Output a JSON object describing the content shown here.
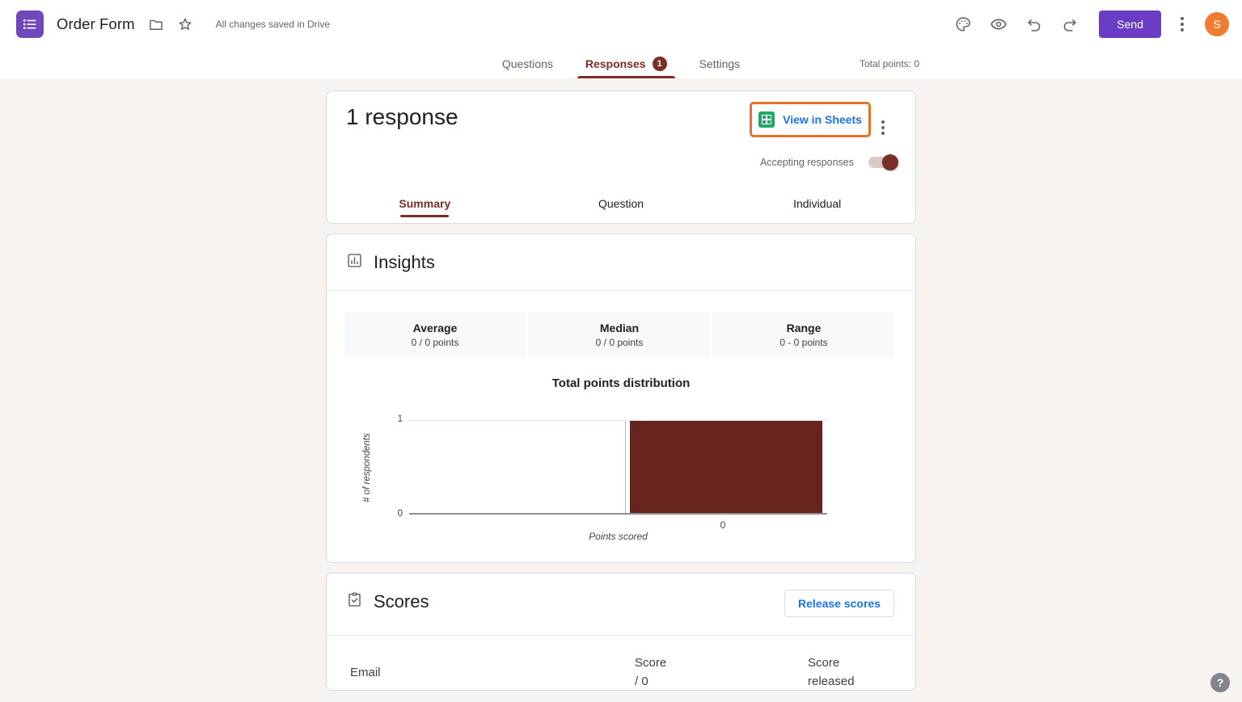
{
  "header": {
    "title": "Order Form",
    "saved_status": "All changes saved in Drive",
    "send_label": "Send",
    "avatar_letter": "S"
  },
  "nav": {
    "tabs": [
      {
        "label": "Questions"
      },
      {
        "label": "Responses",
        "badge": "1"
      },
      {
        "label": "Settings"
      }
    ],
    "total_points": "Total points: 0"
  },
  "response_card": {
    "title": "1 response",
    "view_in_sheets_label": "View in Sheets",
    "accepting_label": "Accepting responses",
    "accepting_on": true,
    "subtabs": [
      {
        "label": "Summary"
      },
      {
        "label": "Question"
      },
      {
        "label": "Individual"
      }
    ]
  },
  "insights": {
    "title": "Insights",
    "stats": [
      {
        "label": "Average",
        "value": "0 / 0 points"
      },
      {
        "label": "Median",
        "value": "0 / 0 points"
      },
      {
        "label": "Range",
        "value": "0 - 0 points"
      }
    ]
  },
  "chart_data": {
    "type": "bar",
    "title": "Total points distribution",
    "xlabel": "Points scored",
    "ylabel": "# of respondents",
    "categories": [
      "0"
    ],
    "values": [
      1
    ],
    "ylim": [
      0,
      1
    ],
    "yticks": [
      "0",
      "1"
    ],
    "grid": "top gridline only, single vertical gridline at bar left edge",
    "bar_color": "#67231d"
  },
  "scores": {
    "title": "Scores",
    "release_label": "Release scores",
    "columns": {
      "email": "Email",
      "score_line1": "Score",
      "score_line2": "/ 0",
      "released_line1": "Score",
      "released_line2": "released"
    }
  },
  "help_label": "?",
  "colors": {
    "maroon": "#7b2e25",
    "bar": "#67231d",
    "blue": "#1a73e8",
    "purple": "#6b3dc7",
    "orange": "#e87326",
    "avatar": "#ee7c31",
    "logo": "#7148b9",
    "bg": "#f6f3f1",
    "toggle_track": "#ddcac7"
  }
}
